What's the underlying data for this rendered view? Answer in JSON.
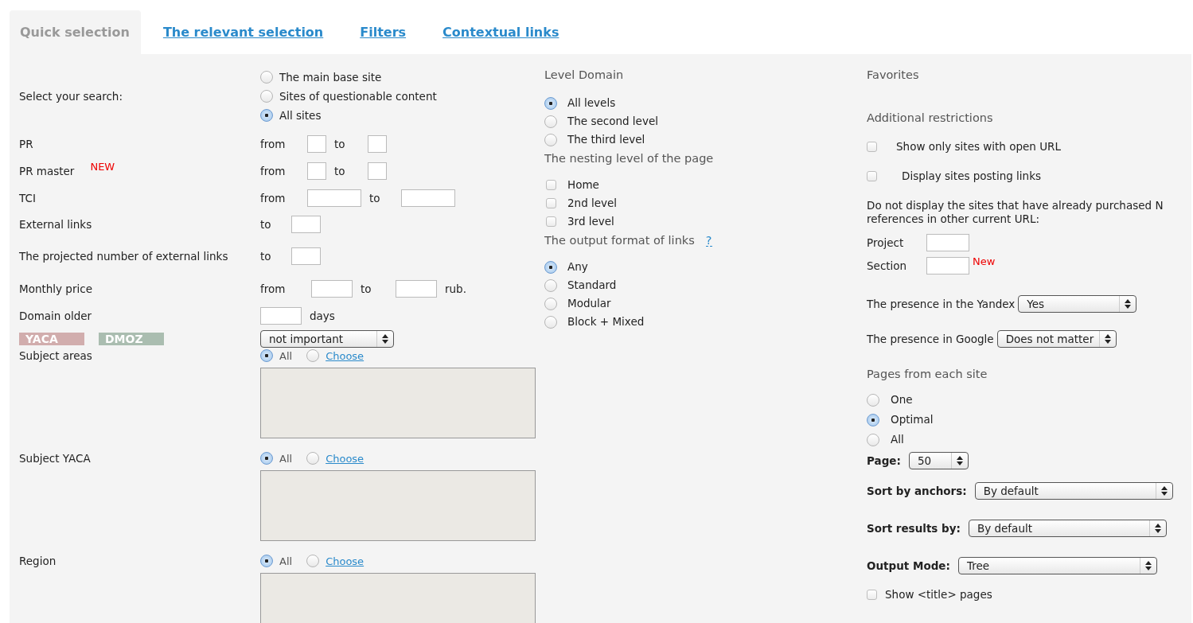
{
  "tabs": [
    {
      "label": "Quick selection",
      "selected": true
    },
    {
      "label": "The relevant selection",
      "selected": false
    },
    {
      "label": "Filters",
      "selected": false
    },
    {
      "label": "Contextual links",
      "selected": false
    }
  ],
  "search": {
    "label": "Select your search:",
    "options": [
      {
        "label": "The main base site",
        "selected": false
      },
      {
        "label": "Sites of questionable content",
        "selected": false
      },
      {
        "label": "All sites",
        "selected": true
      }
    ]
  },
  "filters": [
    {
      "kind": "range",
      "label": "PR",
      "from_label": "from",
      "to_label": "to"
    },
    {
      "kind": "range",
      "label": "PR master",
      "badge": "NEW",
      "from_label": "from",
      "to_label": "to"
    },
    {
      "kind": "range-wide",
      "label": "TCI",
      "from_label": "from",
      "to_label": "to"
    },
    {
      "kind": "max",
      "label": "External links",
      "to_label": "to"
    },
    {
      "kind": "max",
      "label": "The projected number of external links",
      "to_label": "to"
    },
    {
      "kind": "price",
      "label": "Monthly price",
      "from_label": "from",
      "to_label": "to",
      "unit": "rub."
    },
    {
      "kind": "age",
      "label": "Domain older",
      "unit": "days"
    },
    {
      "kind": "catalog",
      "tags": [
        {
          "label": "YACA",
          "color": "#d1adad"
        },
        {
          "label": "DMOZ",
          "color": "#aabdb0"
        }
      ],
      "value": "not important"
    },
    {
      "kind": "subject",
      "label": "Subject areas",
      "options": [
        {
          "label": "All",
          "selected": true
        },
        {
          "label": "Choose",
          "selected": false
        }
      ]
    },
    {
      "kind": "subject",
      "label": "Subject YACA",
      "options": [
        {
          "label": "All",
          "selected": true
        },
        {
          "label": "Choose",
          "selected": false
        }
      ]
    },
    {
      "kind": "subject",
      "label": "Region",
      "options": [
        {
          "label": "All",
          "selected": true
        },
        {
          "label": "Choose",
          "selected": false
        }
      ]
    }
  ],
  "groups": [
    {
      "title": "Level Domain",
      "kind": "radio",
      "items": [
        {
          "label": "All levels",
          "selected": true
        },
        {
          "label": "The second level",
          "selected": false
        },
        {
          "label": "The third level",
          "selected": false
        }
      ]
    },
    {
      "title": "The nesting level of the page",
      "kind": "checkbox",
      "items": [
        {
          "label": "Home",
          "checked": false
        },
        {
          "label": "2nd level",
          "checked": false
        },
        {
          "label": "3rd level",
          "checked": false
        }
      ]
    },
    {
      "title": "The output format of links",
      "help": "?",
      "kind": "radio",
      "items": [
        {
          "label": "Any",
          "selected": true
        },
        {
          "label": "Standard",
          "selected": false
        },
        {
          "label": "Modular",
          "selected": false
        },
        {
          "label": "Block + Mixed",
          "selected": false
        }
      ]
    }
  ],
  "favorites": {
    "title": "Favorites"
  },
  "restrictions": {
    "title": "Additional restrictions",
    "checks": [
      {
        "label": "Show only sites with open URL",
        "checked": false
      },
      {
        "label": "Display sites posting links",
        "checked": false
      }
    ],
    "note": "Do not display the sites that have already purchased N references in other current URL:",
    "fields": [
      {
        "label": "Project"
      },
      {
        "label": "Section",
        "badge": "New"
      }
    ],
    "selects": [
      {
        "label": "The presence in the Yandex",
        "value": "Yes"
      },
      {
        "label": "The presence in Google",
        "value": "Does not matter"
      }
    ]
  },
  "pages": {
    "title": "Pages from each site",
    "options": [
      {
        "label": "One",
        "selected": false
      },
      {
        "label": "Optimal",
        "selected": true
      },
      {
        "label": "All",
        "selected": false
      }
    ],
    "page_label": "Page:",
    "page_value": "50"
  },
  "sorting": [
    {
      "label": "Sort by anchors:",
      "value": "By default"
    },
    {
      "label": "Sort results by:",
      "value": "By default"
    },
    {
      "label": "Output Mode:",
      "value": "Tree"
    }
  ],
  "show_title": {
    "label": "Show <title> pages",
    "checked": false
  }
}
